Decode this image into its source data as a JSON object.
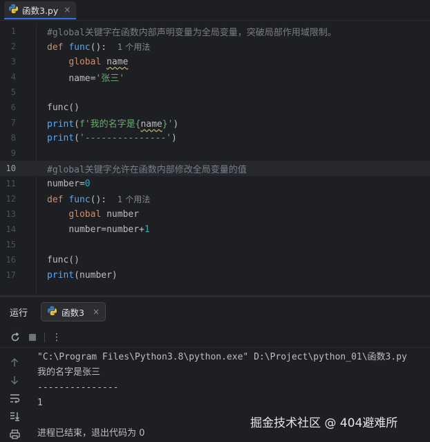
{
  "tab": {
    "filename": "函数3.py",
    "close": "×"
  },
  "editor": {
    "current_line": 10,
    "lines": [
      {
        "n": "1",
        "comment": "#global关键字在函数内部声明变量为全局变量，突破局部作用域限制。"
      },
      {
        "n": "2",
        "kw": "def",
        "name": "func",
        "rest": "():",
        "hint": "1 个用法"
      },
      {
        "n": "3",
        "kw": "global",
        "var": "name"
      },
      {
        "n": "4",
        "lhs": "name=",
        "str": "'张三'"
      },
      {
        "n": "5"
      },
      {
        "n": "6",
        "text": "func()"
      },
      {
        "n": "7",
        "fn": "print",
        "open": "(",
        "str1": "f'我的名字是{",
        "var": "name",
        "str2": "}'",
        "close": ")"
      },
      {
        "n": "8",
        "fn": "print",
        "open": "(",
        "str": "'---------------'",
        "close": ")"
      },
      {
        "n": "9"
      },
      {
        "n": "10",
        "comment": "#global关键字允许在函数内部修改全局变量的值"
      },
      {
        "n": "11",
        "lhs": "number=",
        "num": "0"
      },
      {
        "n": "12",
        "kw": "def",
        "name": "func",
        "rest": "():",
        "hint": "1 个用法"
      },
      {
        "n": "13",
        "kw": "global",
        "var": "number"
      },
      {
        "n": "14",
        "lhs": "number=number+",
        "num": "1"
      },
      {
        "n": "15"
      },
      {
        "n": "16",
        "text": "func()"
      },
      {
        "n": "17",
        "fn": "print",
        "rest": "(number)"
      }
    ]
  },
  "run_panel": {
    "title": "运行",
    "tab_label": "函数3",
    "tab_close": "×",
    "toolbar": [
      "rerun-icon",
      "stop-icon",
      "more-icon"
    ],
    "more_glyph": "⋮",
    "side_tools": [
      "up-arrow-icon",
      "down-arrow-icon",
      "soft-wrap-icon",
      "scroll-to-end-icon",
      "print-icon"
    ],
    "output": [
      "\"C:\\Program Files\\Python3.8\\python.exe\" D:\\Project\\python_01\\函数3.py",
      "我的名字是张三",
      "---------------",
      "1",
      "",
      "进程已结束，退出代码为 0"
    ]
  },
  "watermark": "掘金技术社区 @ 404避难所",
  "colors": {
    "background": "#1e1f22",
    "keyword": "#cf8e6d",
    "function": "#56a8f5",
    "string": "#6aab73",
    "number": "#2aacb8",
    "comment": "#7a7e85",
    "accent": "#3574f0"
  }
}
